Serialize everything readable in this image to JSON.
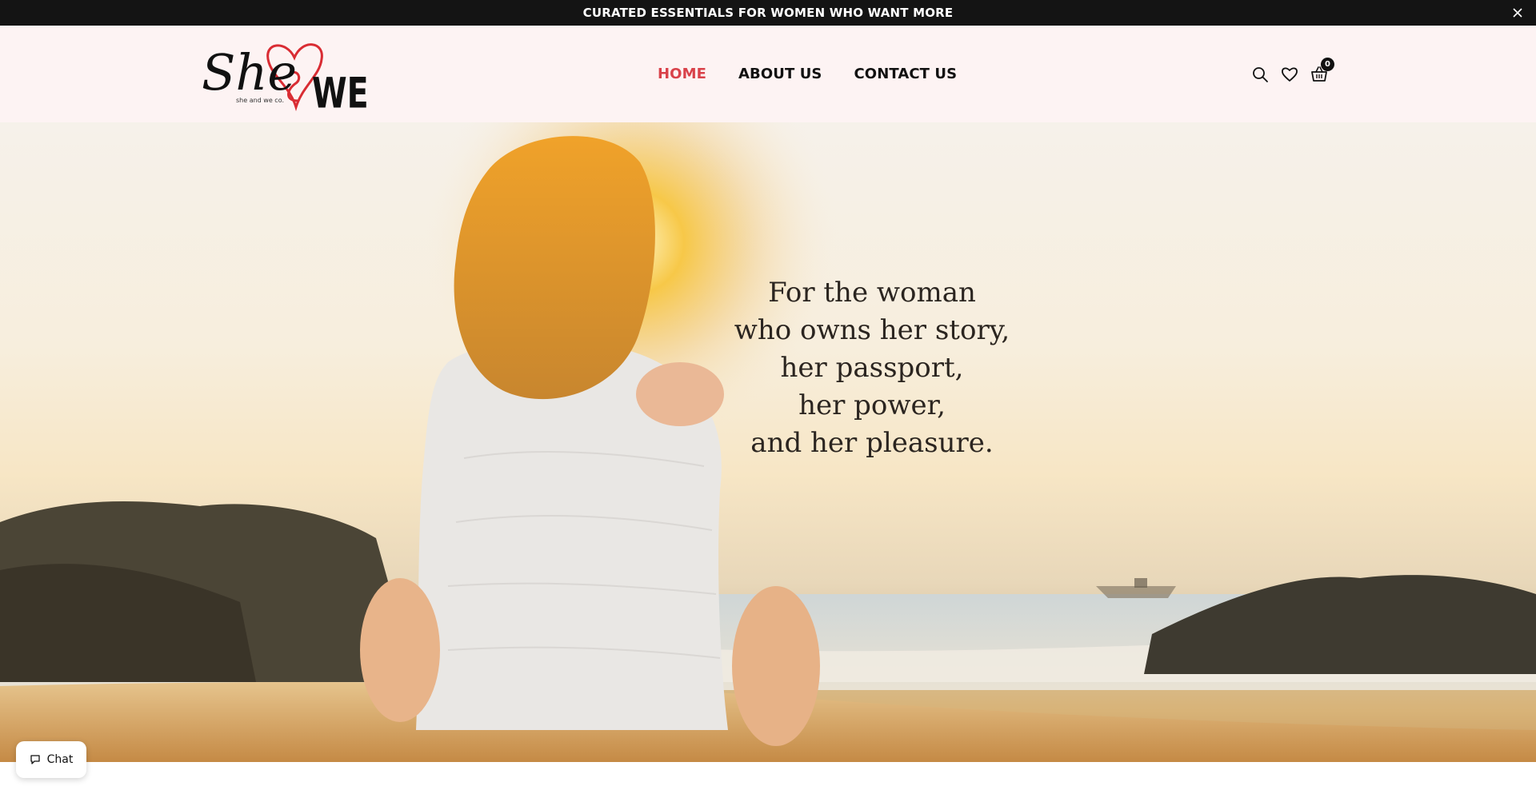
{
  "announcement": {
    "text": "CURATED ESSENTIALS FOR WOMEN WHO WANT MORE",
    "close_icon": "close-icon"
  },
  "header": {
    "logo": {
      "script_text": "She",
      "block_text": "WE",
      "tagline": "she and we co.",
      "heart_color": "#d92c33"
    },
    "nav": [
      {
        "label": "HOME",
        "active": true
      },
      {
        "label": "ABOUT US",
        "active": false
      },
      {
        "label": "CONTACT US",
        "active": false
      }
    ],
    "icons": {
      "search": "search-icon",
      "wishlist": "heart-icon",
      "cart": "basket-icon",
      "cart_count": "0"
    },
    "active_color": "#d9424a",
    "background": "#fdf3f3"
  },
  "hero": {
    "lines": [
      "For the woman",
      "who owns her story,",
      "her passport,",
      "her power,",
      "and her pleasure."
    ]
  },
  "chat": {
    "label": "Chat",
    "icon": "chat-bubble-icon"
  }
}
